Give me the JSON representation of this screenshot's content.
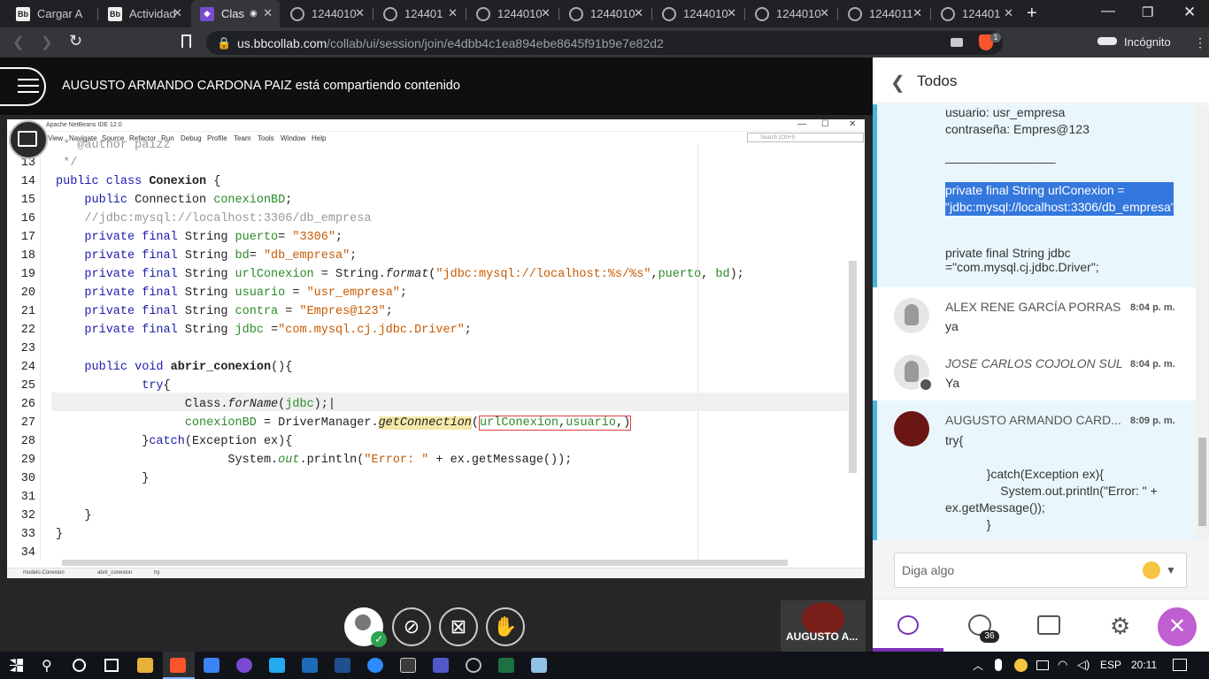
{
  "browser": {
    "tabs": [
      {
        "label": "Cargar A",
        "icon": "bb-icon"
      },
      {
        "label": "Actividad",
        "icon": "bb-icon"
      },
      {
        "label": "Clas",
        "icon": "collab-icon"
      },
      {
        "label": "1244010",
        "icon": "globe-icon"
      },
      {
        "label": "124401",
        "icon": "globe-icon"
      },
      {
        "label": "1244010",
        "icon": "globe-icon"
      },
      {
        "label": "1244010",
        "icon": "globe-icon"
      },
      {
        "label": "1244010",
        "icon": "globe-icon"
      },
      {
        "label": "1244010",
        "icon": "globe-icon"
      },
      {
        "label": "1244011",
        "icon": "globe-icon"
      },
      {
        "label": "124401",
        "icon": "globe-icon"
      }
    ],
    "url_domain": "us.bbcollab.com",
    "url_path": "/collab/ui/session/join/e4dbb4c1ea894ebe8645f91b9e7e82d2",
    "shield_badge": "1",
    "incognito_label": "Incógnito"
  },
  "collab": {
    "sharing_banner": "AUGUSTO ARMANDO CARDONA PAIZ está compartiendo contenido",
    "presenter_name": "AUGUSTO A..."
  },
  "netbeans": {
    "title": "Apache NetBeans IDE 12.0",
    "menu": [
      "View",
      "Navigate",
      "Source",
      "Refactor",
      "Run",
      "Debug",
      "Profile",
      "Team",
      "Tools",
      "Window",
      "Help"
    ],
    "search_placeholder": "Search (Ctrl+I)",
    "breadcrumbs": [
      "modelo.Conexion",
      "abrir_conexion",
      "try"
    ],
    "lines": [
      {
        "n": "",
        "text": " * @author paizz"
      },
      {
        "n": "13",
        "text": " */"
      },
      {
        "n": "14",
        "text": "public class Conexion {"
      },
      {
        "n": "15",
        "text": "    public Connection conexionBD;"
      },
      {
        "n": "16",
        "text": "    //jdbc:mysql://localhost:3306/db_empresa"
      },
      {
        "n": "17",
        "text": "    private final String puerto= \"3306\";"
      },
      {
        "n": "18",
        "text": "    private final String bd= \"db_empresa\";"
      },
      {
        "n": "19",
        "text": "    private final String urlConexion = String.format(\"jdbc:mysql://localhost:%s/%s\",puerto, bd);"
      },
      {
        "n": "20",
        "text": "    private final String usuario = \"usr_empresa\";"
      },
      {
        "n": "21",
        "text": "    private final String contra = \"Empres@123\";"
      },
      {
        "n": "22",
        "text": "    private final String jdbc =\"com.mysql.cj.jdbc.Driver\";"
      },
      {
        "n": "23",
        "text": ""
      },
      {
        "n": "24",
        "text": "    public void abrir_conexion(){"
      },
      {
        "n": "25",
        "text": "        try{"
      },
      {
        "n": "26",
        "text": "            Class.forName(jdbc);"
      },
      {
        "n": "27",
        "text": "            conexionBD = DriverManager.getConnection(urlConexion,usuario,)"
      },
      {
        "n": "28",
        "text": "        }catch(Exception ex){"
      },
      {
        "n": "29",
        "text": "            System.out.println(\"Error: \" + ex.getMessage());"
      },
      {
        "n": "30",
        "text": "        }"
      },
      {
        "n": "31",
        "text": ""
      },
      {
        "n": "32",
        "text": "    }"
      },
      {
        "n": "33",
        "text": "}"
      },
      {
        "n": "34",
        "text": ""
      }
    ]
  },
  "chat": {
    "header": "Todos",
    "first_message": {
      "line1": "usuario: usr_empresa",
      "line2": "contraseña: Empres@123",
      "rule": "________________",
      "highlight": "private final String urlConexion = \"jdbc:mysql://localhost:3306/db_empresa\";",
      "tail": "private final String jdbc =\"com.mysql.cj.jdbc.Driver\";"
    },
    "messages": [
      {
        "author": "ALEX RENE GARCÍA PORRAS",
        "time": "8:04 p. m.",
        "text": "ya"
      },
      {
        "author": "JOSE CARLOS COJOLON SUL",
        "time": "8:04 p. m.",
        "text": "Ya"
      },
      {
        "author": "AUGUSTO ARMANDO CARD...",
        "time": "8:09 p. m.",
        "text": "try{\n\n            }catch(Exception ex){\n                System.out.println(\"Error: \" + ex.getMessage());\n            }"
      }
    ],
    "input_placeholder": "Diga algo",
    "participants_count": "36"
  },
  "taskbar": {
    "lang": "ESP",
    "time": "20:11"
  },
  "colors": {
    "accent": "#7b2fb5",
    "highlight": "#3477dd",
    "selected_msg": "#e9f6fc"
  }
}
